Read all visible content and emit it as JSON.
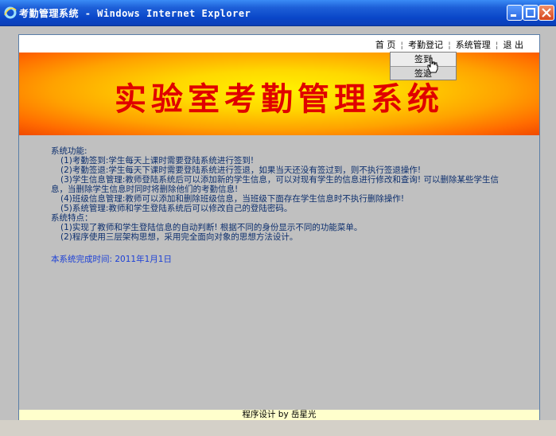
{
  "window": {
    "title": "考勤管理系统 - Windows Internet Explorer",
    "icon": "ie-icon",
    "controls": [
      "minimize-icon",
      "maximize-icon",
      "close-icon"
    ]
  },
  "nav": {
    "items": [
      "首 页",
      "考勤登记",
      "系统管理",
      "退 出"
    ],
    "separator": "¦"
  },
  "dropdown": {
    "items": [
      "签到",
      "签退"
    ]
  },
  "banner": {
    "title": "实验室考勤管理系统",
    "title_color": "#e00000"
  },
  "content": {
    "func_heading": "系统功能:",
    "func_items": [
      "(1)考勤签到:学生每天上课时需要登陆系统进行签到!",
      "(2)考勤签退:学生每天下课时需要登陆系统进行签退，如果当天还没有签过到，则不执行签退操作!",
      "(3)学生信息管理:教师登陆系统后可以添加新的学生信息，可以对现有学生的信息进行修改和查询! 可以删除某些学生信",
      "息，当删除学生信息时同时将删除他们的考勤信息!",
      "(4)班级信息管理:教师可以添加和删除班级信息，当班级下面存在学生信息时不执行删除操作!",
      "(5)系统管理:教师和学生登陆系统后可以修改自己的登陆密码。"
    ],
    "feature_heading": "系统特点：",
    "feature_items": [
      "(1)实现了教师和学生登陆信息的自动判断! 根据不同的身份显示不同的功能菜单。",
      "(2)程序使用三层架构思想，采用完全面向对象的思想方法设计。"
    ],
    "finish_text": "本系统完成时间: 2011年1月1日"
  },
  "footer": {
    "text": "程序设计 by 岳星光"
  }
}
